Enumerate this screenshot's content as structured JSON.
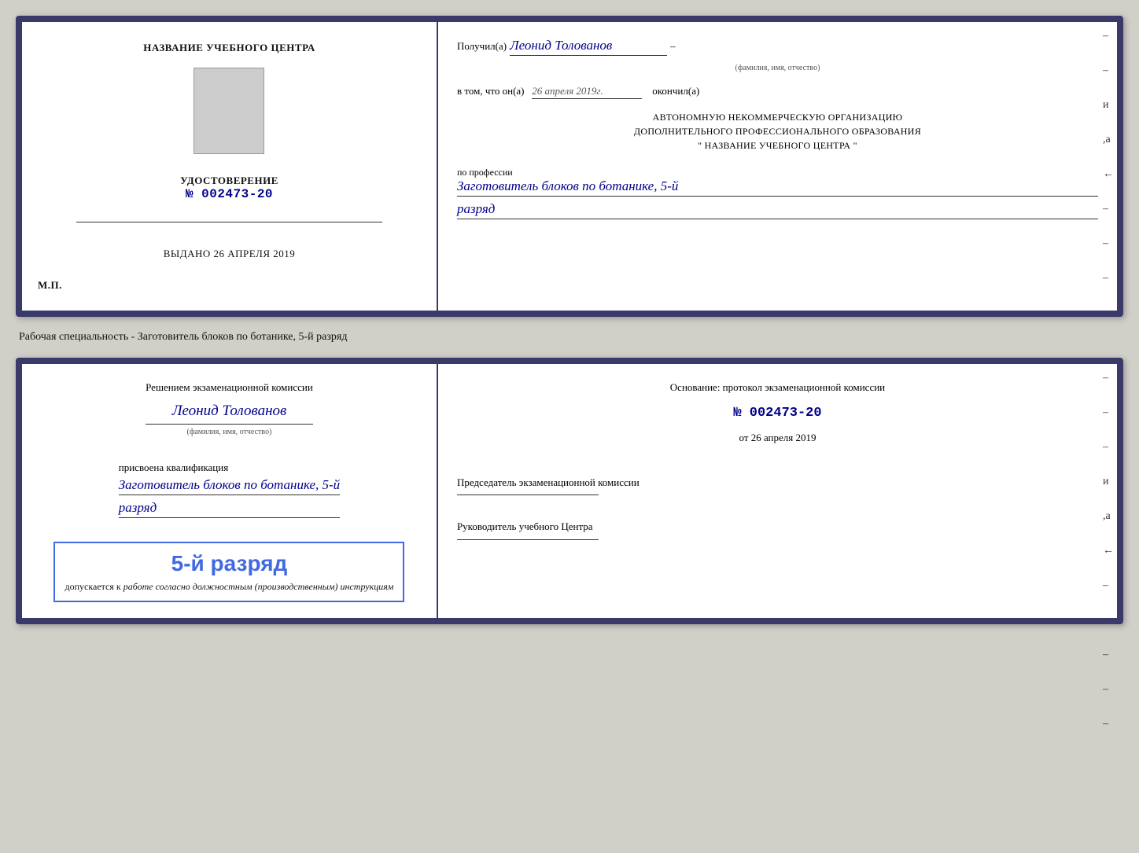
{
  "top_doc": {
    "left": {
      "training_center_label": "НАЗВАНИЕ УЧЕБНОГО ЦЕНТРА",
      "udostoverenie_title": "УДОСТОВЕРЕНИЕ",
      "udostoverenie_number": "№ 002473-20",
      "vydano_label": "Выдано",
      "vydano_date": "26 апреля 2019",
      "mp_label": "М.П."
    },
    "right": {
      "poluchil_label": "Получил(а)",
      "poluchil_name": "Леонид Толованов",
      "fio_caption": "(фамилия, имя, отчество)",
      "vtom_label": "в том, что он(а)",
      "vtom_date": "26 апреля 2019г.",
      "okonchil_label": "окончил(а)",
      "org_line1": "АВТОНОМНУЮ НЕКОММЕРЧЕСКУЮ ОРГАНИЗАЦИЮ",
      "org_line2": "ДОПОЛНИТЕЛЬНОГО ПРОФЕССИОНАЛЬНОГО ОБРАЗОВАНИЯ",
      "org_line3": "\" НАЗВАНИЕ УЧЕБНОГО ЦЕНТРА \"",
      "po_professii_label": "по профессии",
      "profession_name": "Заготовитель блоков по ботанике, 5-й",
      "razryad_val": "разряд"
    }
  },
  "subtitle": "Рабочая специальность - Заготовитель блоков по ботанике, 5-й разряд",
  "bottom_doc": {
    "left": {
      "resheniem_label": "Решением экзаменационной комиссии",
      "name": "Леонид Толованов",
      "fio_caption": "(фамилия, имя, отчество)",
      "prisvoena_label": "присвоена квалификация",
      "profession_name": "Заготовитель блоков по ботанике, 5-й",
      "razryad_val": "разряд",
      "dopuskaetsya_razryad": "5-й разряд",
      "dopuskaetsya_label": "допускается к",
      "dopuskaetsya_text": "работе согласно должностным (производственным) инструкциям"
    },
    "right": {
      "osnovanie_label": "Основание: протокол экзаменационной комиссии",
      "proto_number": "№ 002473-20",
      "ot_label": "от",
      "ot_date": "26 апреля 2019",
      "predsedatel_label": "Председатель экзаменационной комиссии",
      "rukovoditel_label": "Руководитель учебного Центра"
    },
    "dashes": [
      "-",
      "-",
      "-",
      "и",
      ",а",
      "←",
      "-",
      "-",
      "-",
      "-",
      "-"
    ]
  }
}
